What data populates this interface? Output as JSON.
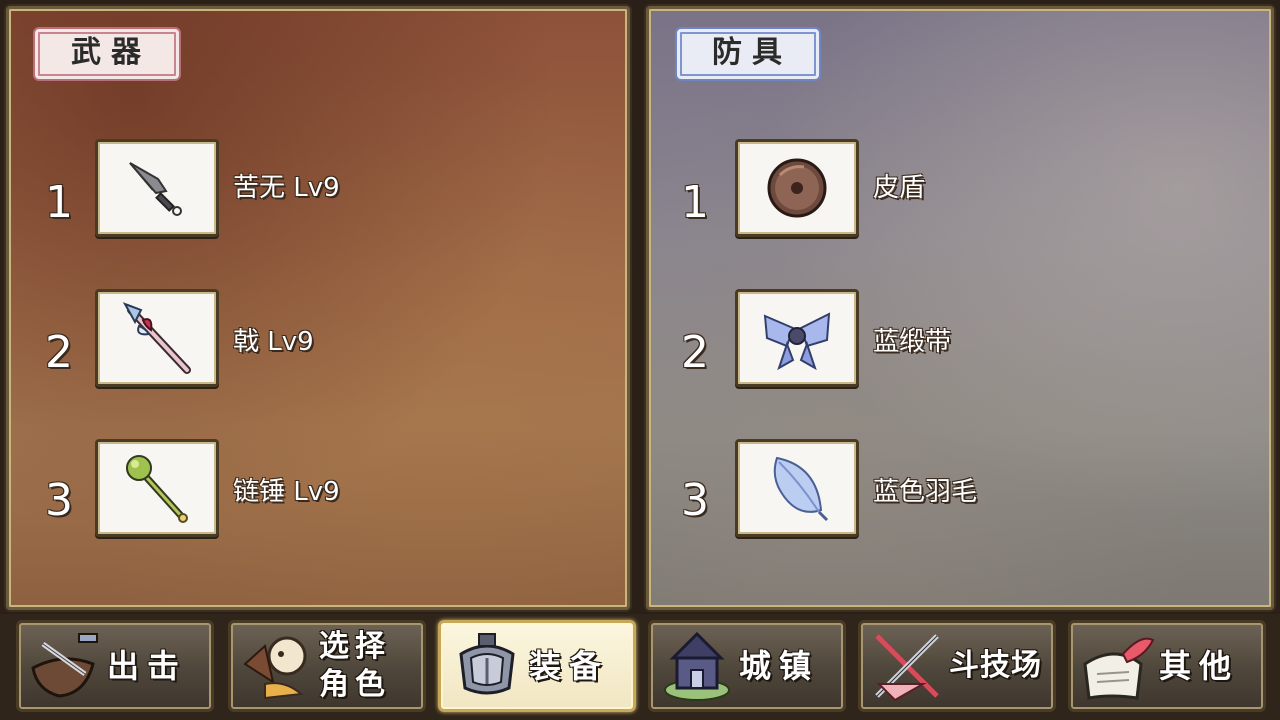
{
  "weapons": {
    "title": "武器",
    "items": [
      {
        "index": "1",
        "label": "苦无 Lv9",
        "icon": "kunai-icon"
      },
      {
        "index": "2",
        "label": "戟 Lv9",
        "icon": "halberd-icon"
      },
      {
        "index": "3",
        "label": "链锤 Lv9",
        "icon": "flail-icon"
      }
    ]
  },
  "armor": {
    "title": "防具",
    "items": [
      {
        "index": "1",
        "label": "皮盾",
        "icon": "leather-shield-icon"
      },
      {
        "index": "2",
        "label": "蓝缎带",
        "icon": "blue-ribbon-icon"
      },
      {
        "index": "3",
        "label": "蓝色羽毛",
        "icon": "blue-feather-icon"
      }
    ]
  },
  "nav": [
    {
      "label": "出击",
      "icon": "sortie-icon",
      "active": false
    },
    {
      "label": "选择角色",
      "icon": "character-select-icon",
      "active": false
    },
    {
      "label": "装备",
      "icon": "equipment-icon",
      "active": true
    },
    {
      "label": "城镇",
      "icon": "town-icon",
      "active": false
    },
    {
      "label": "斗技场",
      "icon": "arena-icon",
      "active": false
    },
    {
      "label": "其他",
      "icon": "other-icon",
      "active": false
    }
  ],
  "colors": {
    "weapons_panel": "#9a6244",
    "armor_panel": "#848093",
    "active_tab": "#f4ebcc"
  }
}
